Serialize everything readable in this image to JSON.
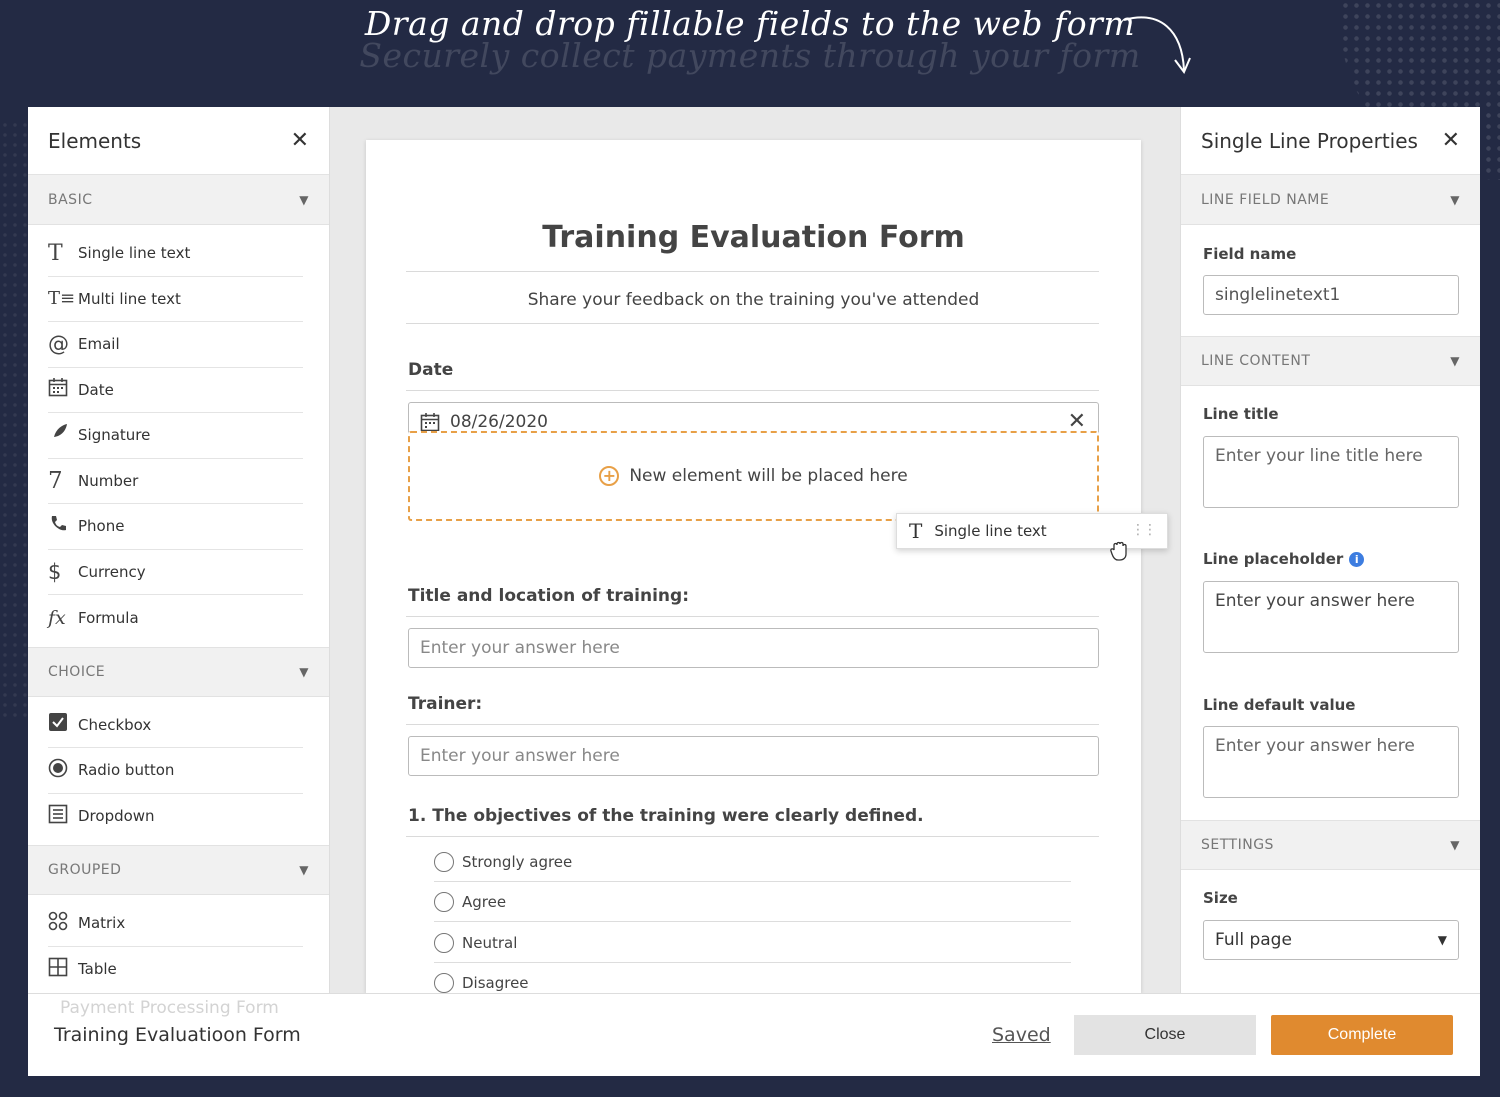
{
  "headline": {
    "main": "Drag and drop fillable fields to the web form",
    "ghost": "Securely collect payments through your form"
  },
  "elements_panel": {
    "title": "Elements",
    "sections": [
      {
        "label": "BASIC",
        "items": [
          {
            "label": "Single line text",
            "icon": "text-icon"
          },
          {
            "label": "Multi line text",
            "icon": "multiline-text-icon"
          },
          {
            "label": "Email",
            "icon": "at-icon"
          },
          {
            "label": "Date",
            "icon": "calendar-icon"
          },
          {
            "label": "Signature",
            "icon": "feather-icon"
          },
          {
            "label": "Number",
            "icon": "seven-icon"
          },
          {
            "label": "Phone",
            "icon": "phone-icon"
          },
          {
            "label": "Currency",
            "icon": "dollar-icon"
          },
          {
            "label": "Formula",
            "icon": "fx-icon"
          }
        ]
      },
      {
        "label": "CHOICE",
        "items": [
          {
            "label": "Checkbox",
            "icon": "checkbox-icon"
          },
          {
            "label": "Radio button",
            "icon": "radio-icon"
          },
          {
            "label": "Dropdown",
            "icon": "list-icon"
          }
        ]
      },
      {
        "label": "GROUPED",
        "items": [
          {
            "label": "Matrix",
            "icon": "matrix-icon"
          },
          {
            "label": "Table",
            "icon": "table-icon"
          }
        ]
      }
    ]
  },
  "form": {
    "title": "Training Evaluation Form",
    "description": "Share your feedback on the training you've attended",
    "date_label": "Date",
    "date_value": "08/26/2020",
    "drop_zone_text": "New element will be placed here",
    "q1_label": "Title and location of training:",
    "q1_placeholder": "Enter your answer here",
    "q2_label": "Trainer:",
    "q2_placeholder": "Enter your answer here",
    "q3_label": "1. The objectives of the training were clearly defined.",
    "q3_options": [
      "Strongly agree",
      "Agree",
      "Neutral",
      "Disagree"
    ]
  },
  "drag_chip": {
    "label": "Single line text"
  },
  "properties_panel": {
    "title": "Single Line Properties",
    "section_field_name": "LINE FIELD NAME",
    "field_name_label": "Field name",
    "field_name_value": "singlelinetext1",
    "section_content": "LINE CONTENT",
    "line_title_label": "Line title",
    "line_title_placeholder": "Enter your line title here",
    "line_placeholder_label": "Line placeholder",
    "line_placeholder_value": "Enter your answer here",
    "line_default_label": "Line default value",
    "line_default_placeholder": "Enter your answer here",
    "section_settings": "SETTINGS",
    "size_label": "Size",
    "size_value": "Full page"
  },
  "footer": {
    "ghost_title": "Payment Processing Form",
    "form_name": "Training Evaluatioon Form",
    "saved": "Saved",
    "close": "Close",
    "complete": "Complete"
  },
  "colors": {
    "background": "#232a44",
    "accent_orange": "#e08a2f",
    "info_blue": "#3d7de0"
  }
}
